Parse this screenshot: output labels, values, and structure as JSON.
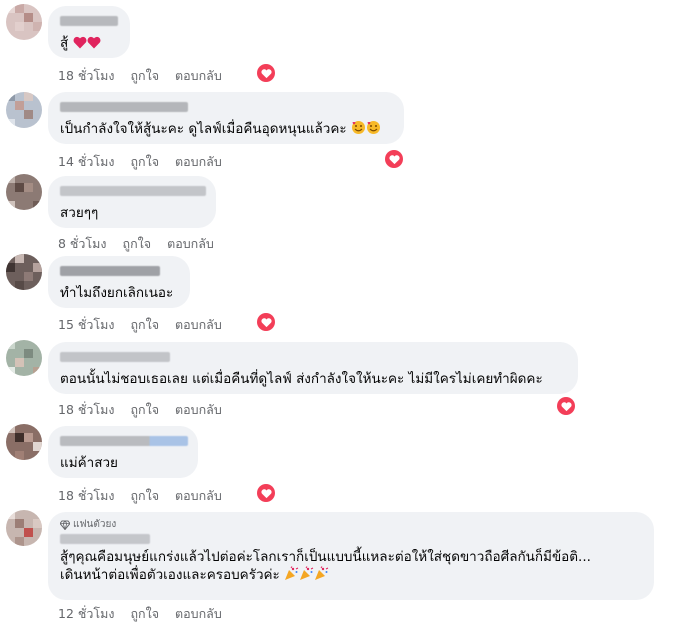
{
  "labels": {
    "like": "ถูกใจ",
    "reply": "ตอบกลับ"
  },
  "badge_text": "แฟนตัวยง",
  "colors": {
    "bubble": "#f0f2f5",
    "meta_text": "#65676b",
    "heart": "#f33e58"
  },
  "comments": [
    {
      "text": "สู้",
      "time": "18 ชั่วโมง"
    },
    {
      "text": "เป็นกำลังใจให้สู้นะคะ ดูไลฟ์เมื่อคืนอุดหนุนแล้วคะ",
      "time": "14 ชั่วโมง"
    },
    {
      "text": "สวยๆๆ",
      "time": "8 ชั่วโมง"
    },
    {
      "text": "ทำไมถึงยกเลิกเนอะ",
      "time": "15 ชั่วโมง"
    },
    {
      "text": "ตอนนั้นไม่ชอบเธอเลย แต่เมื่อคืนที่ดูไลฟ์ ส่งกำลังใจให้นะคะ ไม่มีใครไม่เคยทำผิดคะ",
      "time": "18 ชั่วโมง"
    },
    {
      "text": "แม่ค้าสวย",
      "time": "18 ชั่วโมง"
    },
    {
      "text_line1": "สู้ๆคุณคือมนุษย์แกร่งแล้วไปต่อค่ะโลกเราก็เป็นแบบนี้แหละต่อให้ใส่ชุดขาวถือศีลกันก็มีข้อติ...",
      "text_line2": "เดินหน้าต่อเพื่อตัวเองและครอบครัวค่ะ",
      "time": "12 ชั่วโมง"
    }
  ]
}
